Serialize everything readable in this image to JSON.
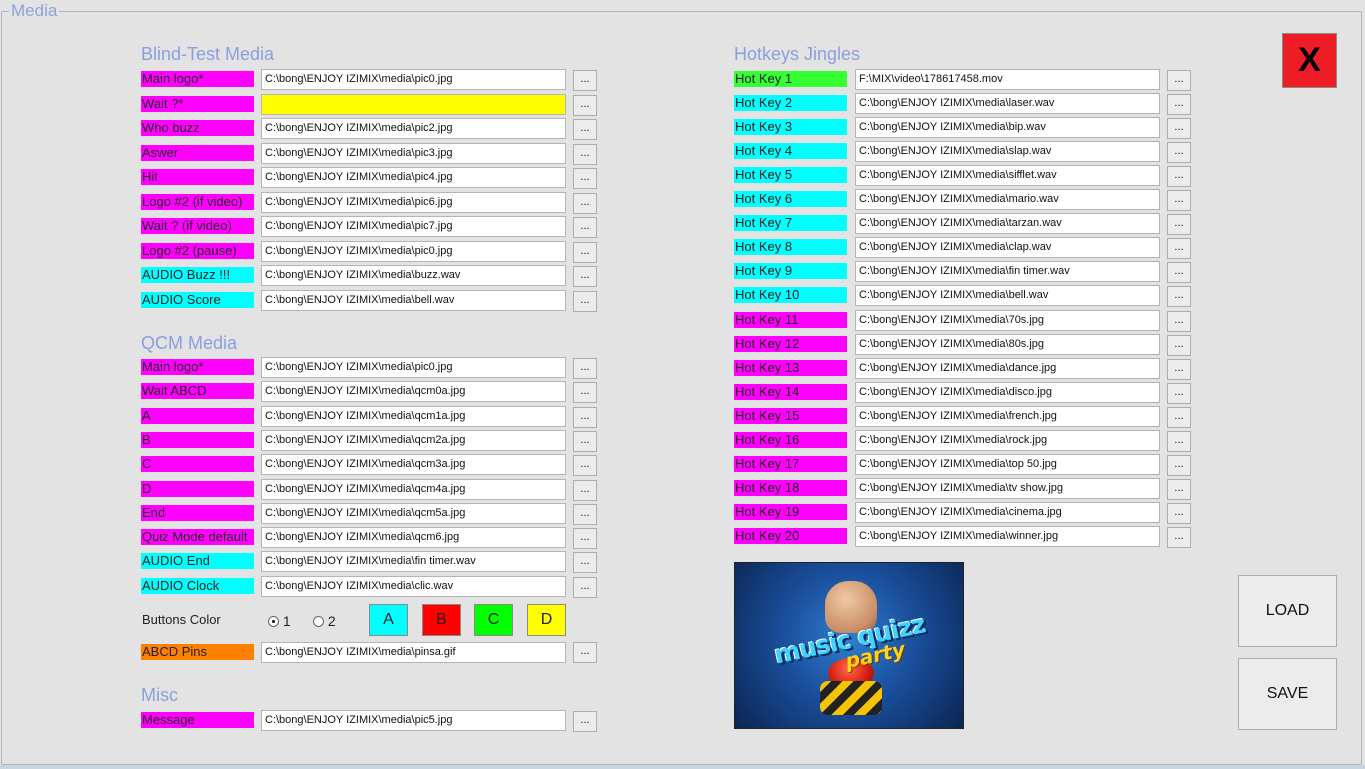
{
  "frame_title": "Media",
  "close_label": "X",
  "load_label": "LOAD",
  "save_label": "SAVE",
  "browse_label": "...",
  "colors": {
    "magenta": "#ff00ff",
    "cyan": "#00ffff",
    "green": "#33ff33",
    "orange": "#ff8000",
    "yellow": "#ffff00",
    "red": "#ff0000",
    "close_red": "#ee1c24",
    "section_title": "#8c9ee0"
  },
  "blind_test": {
    "title": "Blind-Test Media",
    "rows": [
      {
        "label": "Main logo*",
        "color": "#ff00ff",
        "value": "C:\\bong\\ENJOY IZIMIX\\media\\pic0.jpg"
      },
      {
        "label": "Wait ?*",
        "color": "#ff00ff",
        "value": "",
        "field_color": "#ffff00"
      },
      {
        "label": "Who buzz",
        "color": "#ff00ff",
        "value": "C:\\bong\\ENJOY IZIMIX\\media\\pic2.jpg"
      },
      {
        "label": "Aswer",
        "color": "#ff00ff",
        "value": "C:\\bong\\ENJOY IZIMIX\\media\\pic3.jpg"
      },
      {
        "label": "Hit",
        "color": "#ff00ff",
        "value": "C:\\bong\\ENJOY IZIMIX\\media\\pic4.jpg"
      },
      {
        "label": "Logo #2 (if video)",
        "color": "#ff00ff",
        "value": "C:\\bong\\ENJOY IZIMIX\\media\\pic6.jpg"
      },
      {
        "label": "Wait ? (if video)",
        "color": "#ff00ff",
        "value": "C:\\bong\\ENJOY IZIMIX\\media\\pic7.jpg"
      },
      {
        "label": "Logo #2 (pause)",
        "color": "#ff00ff",
        "value": "C:\\bong\\ENJOY IZIMIX\\media\\pic0.jpg"
      },
      {
        "label": "AUDIO Buzz !!!",
        "color": "#00ffff",
        "value": "C:\\bong\\ENJOY IZIMIX\\media\\buzz.wav"
      },
      {
        "label": "AUDIO Score",
        "color": "#00ffff",
        "value": "C:\\bong\\ENJOY IZIMIX\\media\\bell.wav"
      }
    ]
  },
  "qcm": {
    "title": "QCM Media",
    "rows": [
      {
        "label": "Main logo*",
        "color": "#ff00ff",
        "value": "C:\\bong\\ENJOY IZIMIX\\media\\pic0.jpg"
      },
      {
        "label": "Wait ABCD",
        "color": "#ff00ff",
        "value": "C:\\bong\\ENJOY IZIMIX\\media\\qcm0a.jpg"
      },
      {
        "label": "A",
        "color": "#ff00ff",
        "value": "C:\\bong\\ENJOY IZIMIX\\media\\qcm1a.jpg"
      },
      {
        "label": "B",
        "color": "#ff00ff",
        "value": "C:\\bong\\ENJOY IZIMIX\\media\\qcm2a.jpg"
      },
      {
        "label": "C",
        "color": "#ff00ff",
        "value": "C:\\bong\\ENJOY IZIMIX\\media\\qcm3a.jpg"
      },
      {
        "label": "D",
        "color": "#ff00ff",
        "value": "C:\\bong\\ENJOY IZIMIX\\media\\qcm4a.jpg"
      },
      {
        "label": "End",
        "color": "#ff00ff",
        "value": "C:\\bong\\ENJOY IZIMIX\\media\\qcm5a.jpg"
      },
      {
        "label": "Quiz Mode default",
        "color": "#ff00ff",
        "value": "C:\\bong\\ENJOY IZIMIX\\media\\qcm6.jpg"
      },
      {
        "label": "AUDIO End",
        "color": "#00ffff",
        "value": "C:\\bong\\ENJOY IZIMIX\\media\\fin timer.wav"
      },
      {
        "label": "AUDIO Clock",
        "color": "#00ffff",
        "value": "C:\\bong\\ENJOY IZIMIX\\media\\clic.wav"
      }
    ],
    "buttons_color_label": "Buttons Color",
    "radio_1": "1",
    "radio_2": "2",
    "radio_selected": "1",
    "color_buttons": [
      {
        "label": "A",
        "color": "#00ffff"
      },
      {
        "label": "B",
        "color": "#ff0000"
      },
      {
        "label": "C",
        "color": "#00ff00"
      },
      {
        "label": "D",
        "color": "#ffff00"
      }
    ],
    "pins": {
      "label": "ABCD Pins",
      "color": "#ff8000",
      "value": "C:\\bong\\ENJOY IZIMIX\\media\\pinsa.gif"
    }
  },
  "misc": {
    "title": "Misc",
    "rows": [
      {
        "label": "Message",
        "color": "#ff00ff",
        "value": "C:\\bong\\ENJOY IZIMIX\\media\\pic5.jpg"
      }
    ]
  },
  "hotkeys": {
    "title": "Hotkeys Jingles",
    "rows": [
      {
        "label": "Hot Key 1",
        "color": "#33ff33",
        "value": "F:\\MIX\\video\\178617458.mov"
      },
      {
        "label": "Hot Key 2",
        "color": "#00ffff",
        "value": "C:\\bong\\ENJOY IZIMIX\\media\\laser.wav"
      },
      {
        "label": "Hot Key 3",
        "color": "#00ffff",
        "value": "C:\\bong\\ENJOY IZIMIX\\media\\bip.wav"
      },
      {
        "label": "Hot Key 4",
        "color": "#00ffff",
        "value": "C:\\bong\\ENJOY IZIMIX\\media\\slap.wav"
      },
      {
        "label": "Hot Key 5",
        "color": "#00ffff",
        "value": "C:\\bong\\ENJOY IZIMIX\\media\\sifflet.wav"
      },
      {
        "label": "Hot Key 6",
        "color": "#00ffff",
        "value": "C:\\bong\\ENJOY IZIMIX\\media\\mario.wav"
      },
      {
        "label": "Hot Key 7",
        "color": "#00ffff",
        "value": "C:\\bong\\ENJOY IZIMIX\\media\\tarzan.wav"
      },
      {
        "label": "Hot Key 8",
        "color": "#00ffff",
        "value": "C:\\bong\\ENJOY IZIMIX\\media\\clap.wav"
      },
      {
        "label": "Hot Key 9",
        "color": "#00ffff",
        "value": "C:\\bong\\ENJOY IZIMIX\\media\\fin timer.wav"
      },
      {
        "label": "Hot Key 10",
        "color": "#00ffff",
        "value": "C:\\bong\\ENJOY IZIMIX\\media\\bell.wav"
      },
      {
        "label": "Hot Key 11",
        "color": "#ff00ff",
        "value": "C:\\bong\\ENJOY IZIMIX\\media\\70s.jpg"
      },
      {
        "label": "Hot Key 12",
        "color": "#ff00ff",
        "value": "C:\\bong\\ENJOY IZIMIX\\media\\80s.jpg"
      },
      {
        "label": "Hot Key 13",
        "color": "#ff00ff",
        "value": "C:\\bong\\ENJOY IZIMIX\\media\\dance.jpg"
      },
      {
        "label": "Hot Key 14",
        "color": "#ff00ff",
        "value": "C:\\bong\\ENJOY IZIMIX\\media\\disco.jpg"
      },
      {
        "label": "Hot Key 15",
        "color": "#ff00ff",
        "value": "C:\\bong\\ENJOY IZIMIX\\media\\french.jpg"
      },
      {
        "label": "Hot Key 16",
        "color": "#ff00ff",
        "value": "C:\\bong\\ENJOY IZIMIX\\media\\rock.jpg"
      },
      {
        "label": "Hot Key 17",
        "color": "#ff00ff",
        "value": "C:\\bong\\ENJOY IZIMIX\\media\\top 50.jpg"
      },
      {
        "label": "Hot Key 18",
        "color": "#ff00ff",
        "value": "C:\\bong\\ENJOY IZIMIX\\media\\tv show.jpg"
      },
      {
        "label": "Hot Key 19",
        "color": "#ff00ff",
        "value": "C:\\bong\\ENJOY IZIMIX\\media\\cinema.jpg"
      },
      {
        "label": "Hot Key 20",
        "color": "#ff00ff",
        "value": "C:\\bong\\ENJOY IZIMIX\\media\\winner.jpg"
      }
    ]
  },
  "preview": {
    "logo_line1": "music quizz",
    "logo_line2": "party"
  }
}
